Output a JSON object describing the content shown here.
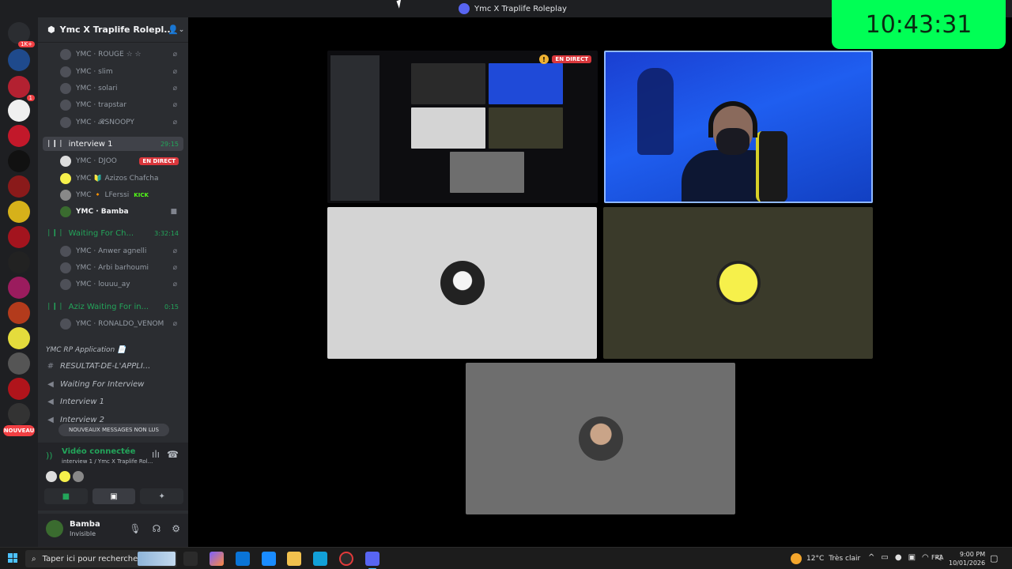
{
  "window": {
    "title": "Ymc X Traplife Roleplay"
  },
  "clock": {
    "time": "10:43:31"
  },
  "rail": {
    "mention_count": "1K+",
    "badge_1": "1",
    "nouveau": "NOUVEAU"
  },
  "server": {
    "name": "Ymc X Traplife Rolepl..."
  },
  "channels": {
    "top_members": [
      {
        "name": "YMC · ROUGE ☆ ☆"
      },
      {
        "name": "YMC · slim"
      },
      {
        "name": "YMC · solari"
      },
      {
        "name": "YMC · trapstar"
      },
      {
        "name": "YMC · 𝓡SNOOPY"
      }
    ],
    "interview1": {
      "name": "interview 1",
      "timer": "29:15"
    },
    "interview1_members": [
      {
        "name": "YMC · DJOO",
        "live": "EN DIRECT"
      },
      {
        "name": "YMC 🔰 Azizos Chafcha"
      },
      {
        "name": "YMC 🔸 LFerssi",
        "extra": "KICK"
      },
      {
        "name": "YMC · Bamba"
      }
    ],
    "waiting_ch": {
      "name": "Waiting For Ch...",
      "timer": "3:32:14"
    },
    "waiting_members": [
      {
        "name": "YMC · Anwer agnelli"
      },
      {
        "name": "YMC · Arbi barhoumi"
      },
      {
        "name": "YMC · louuu_ay"
      }
    ],
    "aziz_waiting": {
      "name": "Aziz Waiting For in...",
      "timer": "0:15"
    },
    "aziz_members": [
      {
        "name": "YMC · RONALDO_VENOM"
      }
    ],
    "category": "YMC RP Application 📄",
    "text_channels": [
      {
        "name": "RESULTAT-DE-L'APPLI..."
      },
      {
        "name": "Waiting For Interview"
      },
      {
        "name": "Interview 1"
      },
      {
        "name": "Interview 2"
      }
    ],
    "unread_pill": "NOUVEAUX MESSAGES NON LUS"
  },
  "voice_panel": {
    "status": "Vidéo connectée",
    "sub": "interview 1 / Ymc X Traplife Rol..."
  },
  "user": {
    "name": "Bamba",
    "status": "Invisible"
  },
  "screen_share": {
    "live": "EN DIRECT"
  },
  "taskbar": {
    "search_placeholder": "Taper ici pour rechercher",
    "temperature": "12°C",
    "weather": "Très clair",
    "lang": "FRA",
    "time": "9:00 PM",
    "date": "10/01/2026"
  },
  "colors": {
    "clock_bg": "#00ff55",
    "accent_green": "#23a55a",
    "live_red": "#da373c",
    "sidebar": "#2b2d31"
  }
}
